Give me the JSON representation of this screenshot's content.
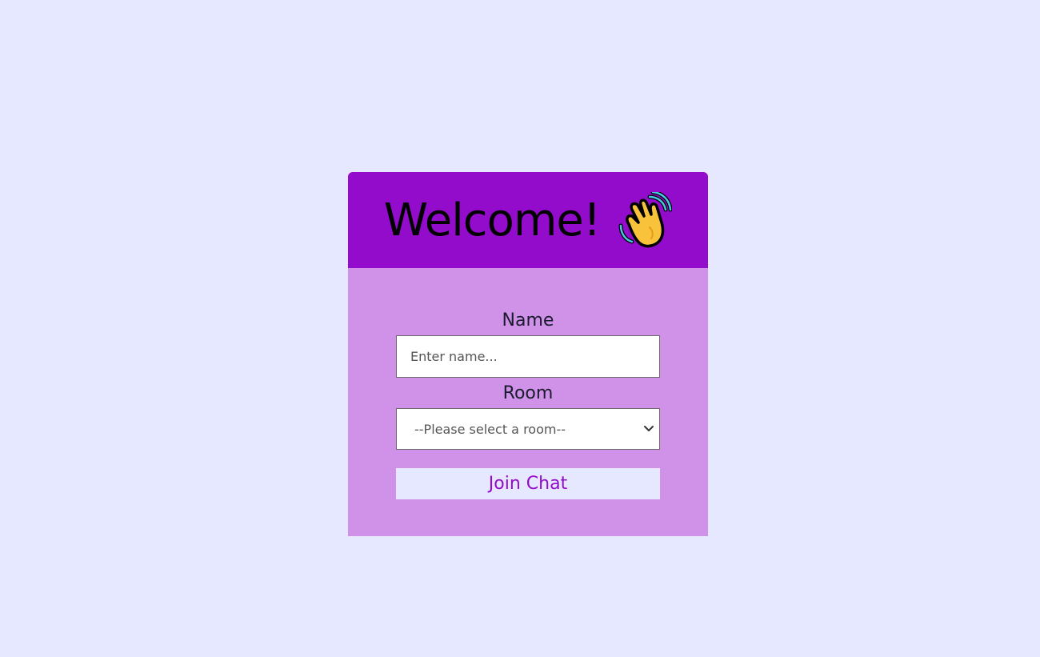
{
  "header": {
    "title": "Welcome!",
    "icon": "waving-hand-icon"
  },
  "form": {
    "name_label": "Name",
    "name_placeholder": "Enter name...",
    "name_value": "",
    "room_label": "Room",
    "room_selected": "--Please select a room--",
    "join_label": "Join Chat"
  },
  "colors": {
    "page_background": "#e6e8ff",
    "header_background": "#930bcb",
    "card_background": "#cf92e8",
    "button_text": "#930bcb"
  }
}
